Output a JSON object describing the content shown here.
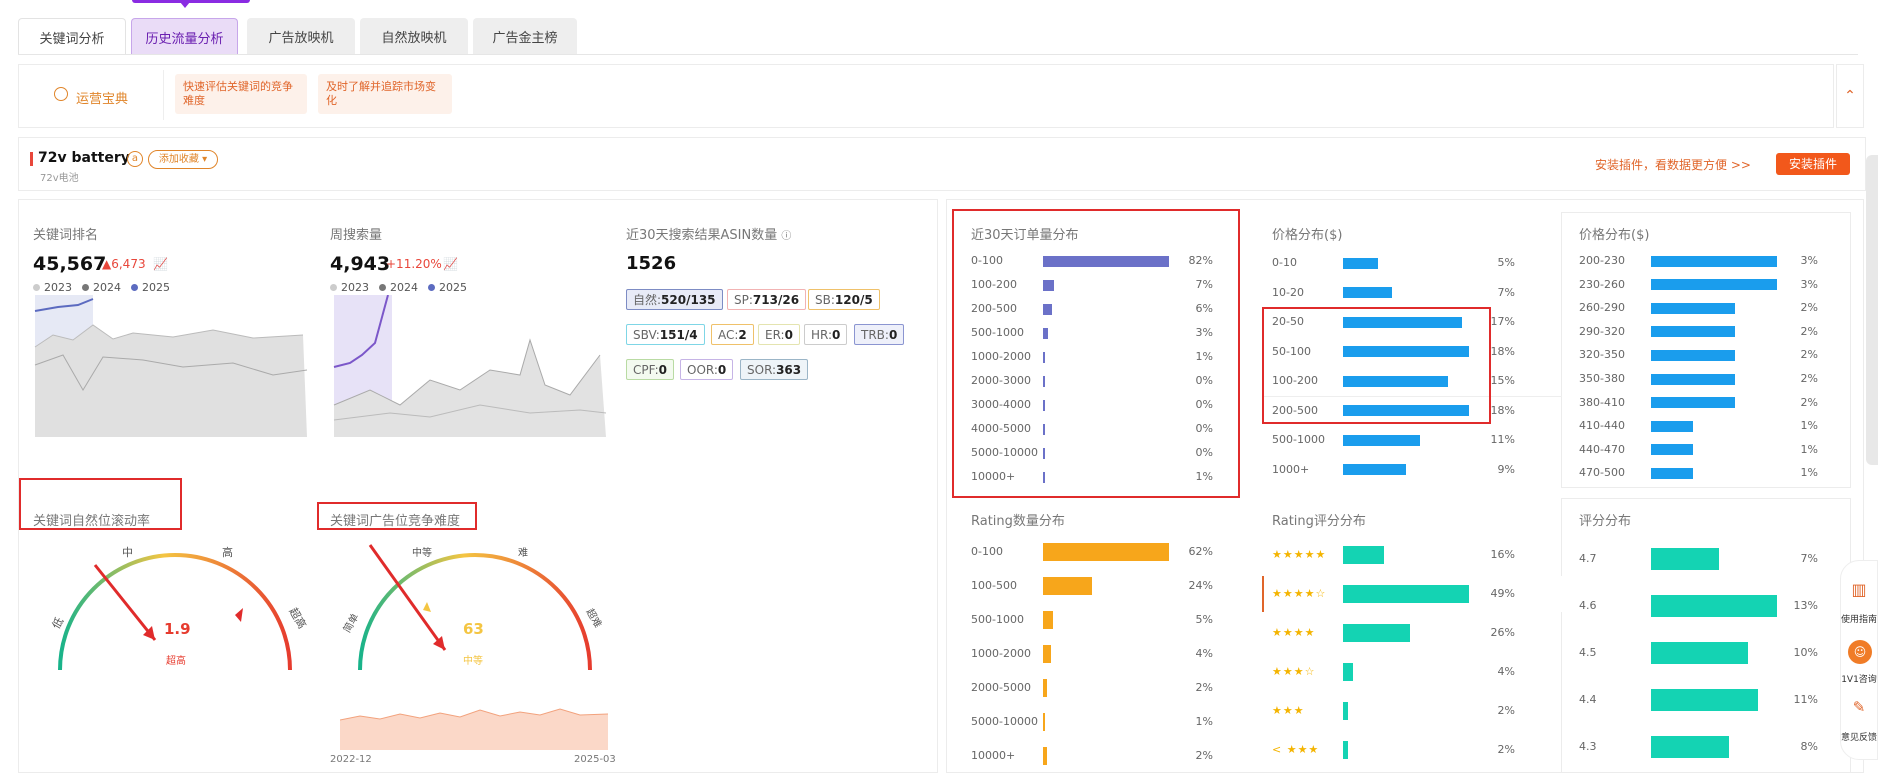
{
  "tabs": [
    "关键词分析",
    "历史流量分析",
    "广告放映机",
    "自然放映机",
    "广告金主榜"
  ],
  "tips": {
    "label": "运营宝典",
    "tip1": "快速评估关键词的竞争难度",
    "tip2": "及时了解并追踪市场变化"
  },
  "keyword": {
    "name": "72v battery",
    "badge": "a",
    "collect": "添加收藏",
    "translation": "72v电池",
    "install_text": "安装插件，看数据更方便 >>",
    "install_button": "安装插件"
  },
  "rank": {
    "title": "关键词排名",
    "value": "45,567",
    "delta": "▲6,473"
  },
  "search": {
    "title": "周搜索量",
    "value": "4,943",
    "delta": "+11.20%"
  },
  "years": [
    "2023",
    "2024",
    "2025"
  ],
  "asin": {
    "title": "近30天搜索结果ASIN数量",
    "value": "1526",
    "tags": [
      {
        "k": "自然:",
        "v": "520/135"
      },
      {
        "k": "SP:",
        "v": "713/26"
      },
      {
        "k": "SB:",
        "v": "120/5"
      },
      {
        "k": "SBV:",
        "v": "151/4"
      },
      {
        "k": "AC:",
        "v": "2"
      },
      {
        "k": "ER:",
        "v": "0"
      },
      {
        "k": "HR:",
        "v": "0"
      },
      {
        "k": "TRB:",
        "v": "0"
      },
      {
        "k": "CPF:",
        "v": "0"
      },
      {
        "k": "OOR:",
        "v": "0"
      },
      {
        "k": "SOR:",
        "v": "363"
      }
    ]
  },
  "gauge1": {
    "title": "关键词自然位滚动率",
    "value": "1.9",
    "level": "超高",
    "labels": [
      "低",
      "中",
      "高",
      "超高"
    ]
  },
  "gauge2": {
    "title": "关键词广告位竞争难度",
    "value": "63",
    "level": "中等",
    "labels": [
      "简单",
      "中等",
      "难",
      "超难"
    ],
    "start": "2022-12",
    "end": "2025-03"
  },
  "orders": {
    "title": "近30天订单量分布",
    "rows": [
      [
        "0-100",
        82
      ],
      [
        "100-200",
        7
      ],
      [
        "200-500",
        6
      ],
      [
        "500-1000",
        3
      ],
      [
        "1000-2000",
        1
      ],
      [
        "2000-3000",
        0
      ],
      [
        "3000-4000",
        0
      ],
      [
        "4000-5000",
        0
      ],
      [
        "5000-10000",
        0
      ],
      [
        "10000+",
        1
      ]
    ]
  },
  "price1": {
    "title": "价格分布($)",
    "rows": [
      [
        "0-10",
        5
      ],
      [
        "10-20",
        7
      ],
      [
        "20-50",
        17
      ],
      [
        "50-100",
        18
      ],
      [
        "100-200",
        15
      ],
      [
        "200-500",
        18
      ],
      [
        "500-1000",
        11
      ],
      [
        "1000+",
        9
      ]
    ]
  },
  "price2": {
    "title": "价格分布($)",
    "rows": [
      [
        "200-230",
        3
      ],
      [
        "230-260",
        3
      ],
      [
        "260-290",
        2
      ],
      [
        "290-320",
        2
      ],
      [
        "320-350",
        2
      ],
      [
        "350-380",
        2
      ],
      [
        "380-410",
        2
      ],
      [
        "410-440",
        1
      ],
      [
        "440-470",
        1
      ],
      [
        "470-500",
        1
      ]
    ]
  },
  "ratingcount": {
    "title": "Rating数量分布",
    "rows": [
      [
        "0-100",
        62
      ],
      [
        "100-500",
        24
      ],
      [
        "500-1000",
        5
      ],
      [
        "1000-2000",
        4
      ],
      [
        "2000-5000",
        2
      ],
      [
        "5000-10000",
        1
      ],
      [
        "10000+",
        2
      ]
    ]
  },
  "ratingscore": {
    "title": "Rating评分分布",
    "rows": [
      [
        "★★★★★",
        16
      ],
      [
        "★★★★☆",
        49
      ],
      [
        "★★★★",
        26
      ],
      [
        "★★★☆",
        4
      ],
      [
        "★★★",
        2
      ],
      [
        "< ★★★",
        2
      ]
    ]
  },
  "scoredist": {
    "title": "评分分布",
    "rows": [
      [
        "4.7",
        7
      ],
      [
        "4.6",
        13
      ],
      [
        "4.5",
        10
      ],
      [
        "4.4",
        11
      ],
      [
        "4.3",
        8
      ]
    ]
  },
  "side": {
    "guide": "使用指南",
    "consult": "1V1咨询",
    "feedback": "意见反馈"
  }
}
